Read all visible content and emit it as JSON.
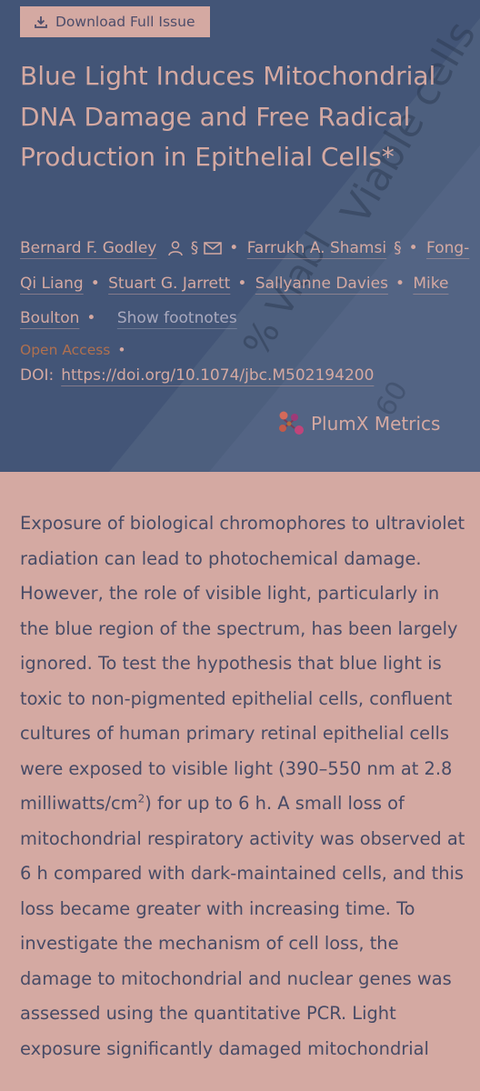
{
  "header": {
    "download_label": "Download Full Issue",
    "title": "Blue Light Induces Mitochondrial DNA Damage and Free Radical Production in Epithelial Cells*",
    "authors": [
      {
        "name": "Bernard F. Godley"
      },
      {
        "name": "Farrukh A. Shamsi"
      },
      {
        "name": "Fong-Qi Liang"
      },
      {
        "name": "Stuart G. Jarrett"
      },
      {
        "name": "Sallyanne Davies"
      },
      {
        "name": "Mike Boulton"
      }
    ],
    "section_symbol": "§",
    "bullet": "•",
    "show_footnotes": "Show footnotes",
    "open_access": "Open Access",
    "doi_label": "DOI:",
    "doi_link": "https://doi.org/10.1074/jbc.M502194200",
    "plumx_label": "PlumX Metrics",
    "background_text": {
      "line1": "Viable cells",
      "line2": "% Viabl",
      "line3": "60"
    }
  },
  "abstract": {
    "before_sup": "Exposure of biological chromophores to ultraviolet radiation can lead to photochemical damage. However, the role of visible light, particularly in the blue region of the spectrum, has been largely ignored. To test the hypothesis that blue light is toxic to non-pigmented epithelial cells, confluent cultures of human primary retinal epithelial cells were exposed to visible light (390–550 nm at 2.8 milliwatts/cm",
    "sup": "2",
    "after_sup": ") for up to 6 h. A small loss of mitochondrial respiratory activity was observed at 6 h compared with dark-maintained cells, and this loss became greater with increasing time. To investigate the mechanism of cell loss, the damage to mitochondrial and nuclear genes was assessed using the quantitative PCR. Light exposure significantly damaged mitochondrial"
  },
  "colors": {
    "header_bg": "#435577",
    "page_bg": "#d4a9a2",
    "accent_open_access": "#b0704f",
    "body_text": "#474b66"
  }
}
